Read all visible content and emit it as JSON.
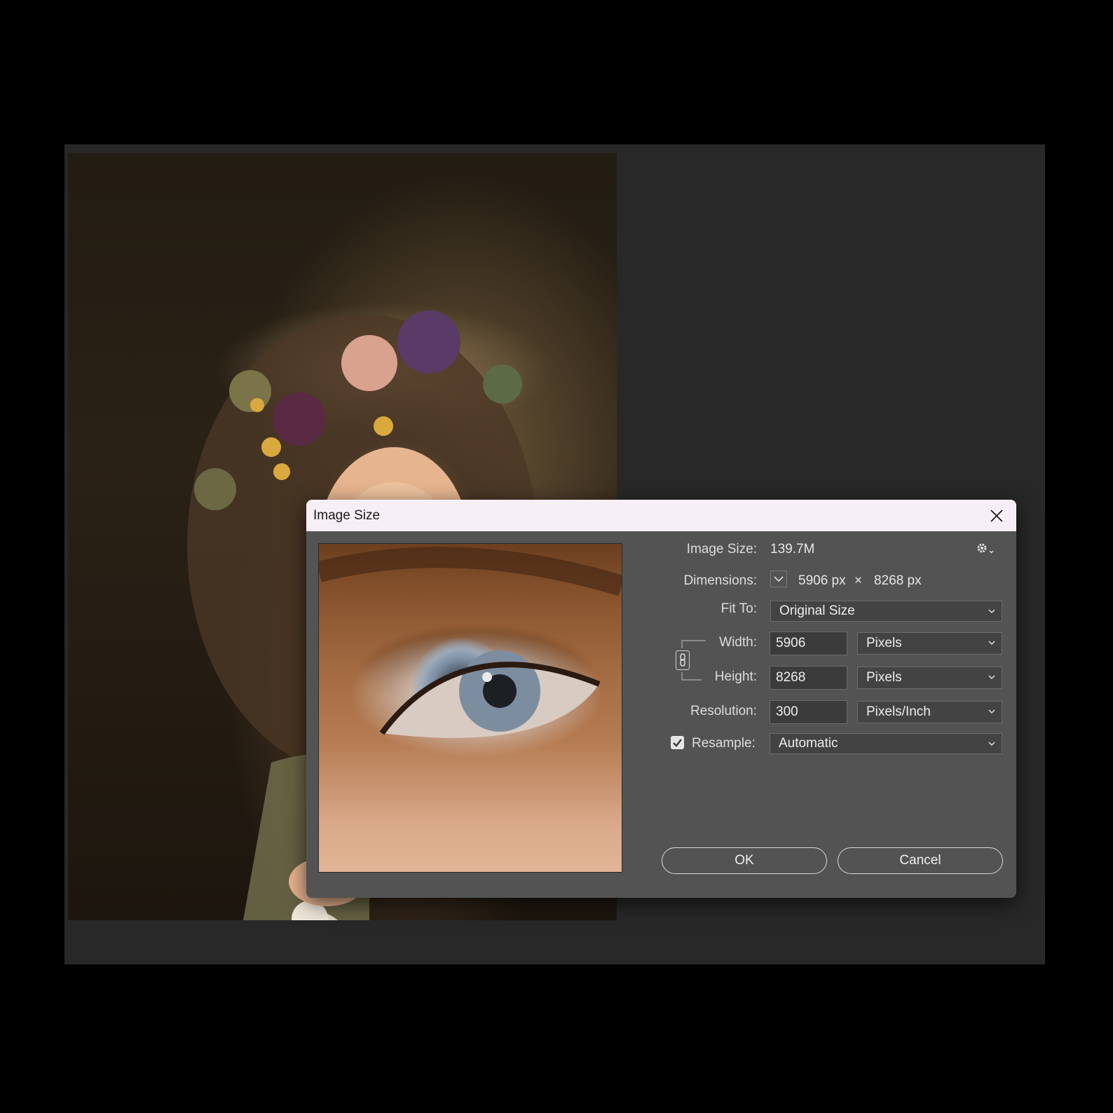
{
  "dialog": {
    "title": "Image Size",
    "image_size_label": "Image Size:",
    "image_size_value": "139.7M",
    "dimensions_label": "Dimensions:",
    "dimensions_width": "5906 px",
    "dimensions_times": "×",
    "dimensions_height": "8268 px",
    "fit_to_label": "Fit To:",
    "fit_to_value": "Original Size",
    "width_label": "Width:",
    "width_value": "5906",
    "width_unit": "Pixels",
    "height_label": "Height:",
    "height_value": "8268",
    "height_unit": "Pixels",
    "resolution_label": "Resolution:",
    "resolution_value": "300",
    "resolution_unit": "Pixels/Inch",
    "resample_label": "Resample:",
    "resample_checked": true,
    "resample_value": "Automatic",
    "ok_label": "OK",
    "cancel_label": "Cancel"
  },
  "icons": {
    "close": "close-icon",
    "settings": "gear-icon",
    "dimensions_toggle": "chevron-down-icon",
    "constrain": "link-icon",
    "checkbox": "checkmark-icon"
  },
  "colors": {
    "title_bar": "#f7eff6",
    "dialog_bg": "#535353",
    "workspace_bg": "#282828"
  }
}
